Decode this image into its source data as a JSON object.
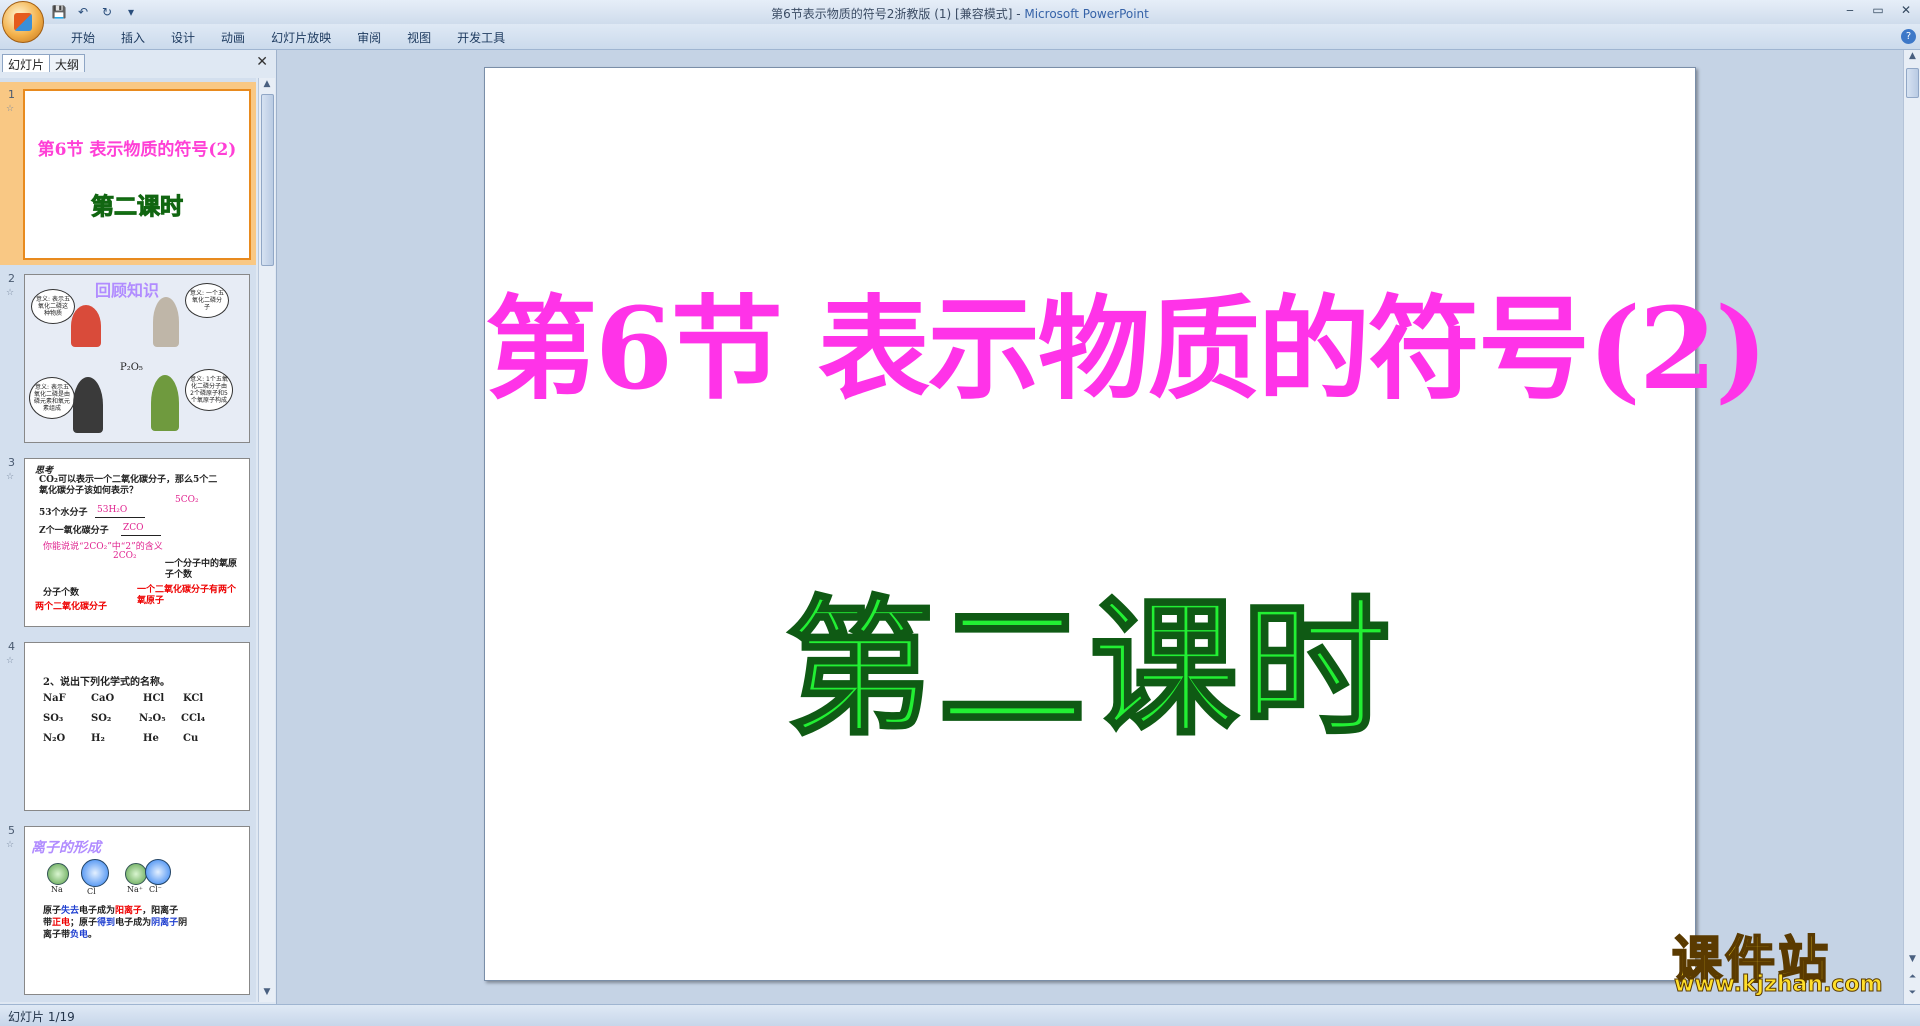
{
  "window": {
    "title": "第6节表示物质的符号2浙教版 (1) [兼容模式] - ",
    "app": "Microsoft PowerPoint"
  },
  "ribbon": {
    "tabs": [
      "开始",
      "插入",
      "设计",
      "动画",
      "幻灯片放映",
      "审阅",
      "视图",
      "开发工具"
    ]
  },
  "panel": {
    "tabs": [
      "幻灯片",
      "大纲"
    ],
    "close": "✕"
  },
  "slides": [
    {
      "num": "1",
      "title": "第6节 表示物质的符号(2)",
      "subtitle": "第二课时"
    },
    {
      "num": "2",
      "title": "回顾知识",
      "formula": "P₂O₅",
      "bubbles": [
        "意义: 表示五氧化二磷这种物质",
        "意义: 一个五氧化二磷分子",
        "意义: 表示五氧化二磷是由磷元素和氧元素组成",
        "意义: 1个五氧化二磷分子由2个磷原子和5个氧原子构成"
      ]
    },
    {
      "num": "3",
      "lines": {
        "head": "思考",
        "q": "CO₂可以表示一个二氧化碳分子，那么5个二氧化碳分子该如何表示？",
        "ans1": "5CO₂",
        "water": "53个水分子",
        "water_ans": "53H₂O",
        "co": "Z个一氧化碳分子",
        "co_ans": "ZCO",
        "meaning": "你能说说“2CO₂”中“2”的含义",
        "formula": "2CO₂",
        "right1": "一个分子中的氧原子个数",
        "left1": "分子个数",
        "left2": "两个二氧化碳分子",
        "right2": "一个二氧化碳分子有两个氧原子"
      }
    },
    {
      "num": "4",
      "heading": "2、说出下列化学式的名称。",
      "rows": [
        [
          "NaF",
          "CaO",
          "HCl",
          "KCl"
        ],
        [
          "SO₃",
          "SO₂",
          "N₂O₅",
          "CCl₄"
        ],
        [
          "N₂O",
          "H₂",
          "He",
          "Cu"
        ]
      ]
    },
    {
      "num": "5",
      "title": "离子的形成",
      "labels": [
        "Na",
        "Cl",
        "Na⁺",
        "Cl⁻"
      ],
      "text1a": "原子",
      "text1b": "失去",
      "text1c": "电子成为",
      "text1d": "阳离子",
      "text1e": "，阳离子",
      "text2a": "带",
      "text2b": "正电",
      "text2c": "；原子",
      "text2d": "得到",
      "text2e": "电子成为",
      "text2f": "阴离子",
      "text2g": "阴",
      "text3a": "离子带",
      "text3b": "负电",
      "text3c": "。"
    }
  ],
  "main_slide": {
    "title": "第6节  表示物质的符号(2)",
    "subtitle": "第二课时"
  },
  "status": {
    "text": "幻灯片 1/19"
  },
  "watermark": {
    "main": "课件站",
    "url": "www.kjzhan.com"
  },
  "colors": {
    "title_pink": "#ff33e8",
    "subtitle_green": "#22f033",
    "selection": "#f9c884"
  }
}
